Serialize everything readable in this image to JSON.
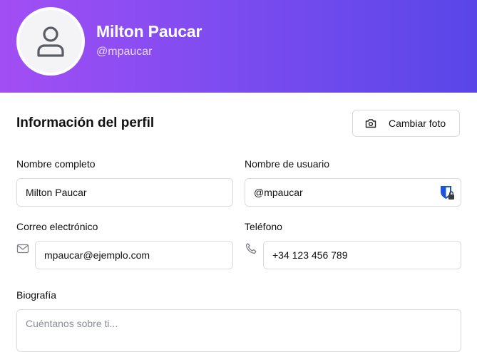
{
  "header": {
    "name": "Milton Paucar",
    "handle": "@mpaucar",
    "avatar_icon": "user-icon",
    "gradient": [
      "#a24ef4",
      "#5946e8"
    ]
  },
  "section": {
    "title": "Información del perfil",
    "change_photo_label": "Cambiar foto",
    "change_photo_icon": "camera-icon"
  },
  "form": {
    "full_name": {
      "label": "Nombre completo",
      "value": "Milton Paucar"
    },
    "username": {
      "label": "Nombre de usuario",
      "value": "@mpaucar",
      "badge_icon": "password-manager-shield-icon"
    },
    "email": {
      "label": "Correo electrónico",
      "value": "mpaucar@ejemplo.com",
      "icon": "mail-icon"
    },
    "phone": {
      "label": "Teléfono",
      "value": "+34 123 456 789",
      "icon": "phone-icon"
    },
    "bio": {
      "label": "Biografía",
      "placeholder": "Cuéntanos sobre ti..."
    }
  }
}
